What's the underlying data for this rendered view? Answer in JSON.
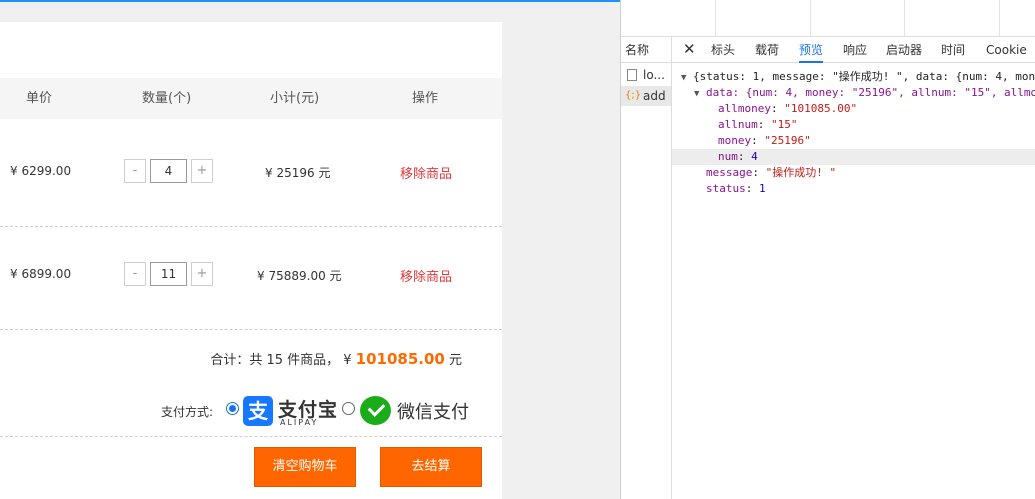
{
  "cart": {
    "headers": {
      "price": "单价",
      "qty": "数量(个)",
      "subtotal": "小计(元)",
      "action": "操作"
    },
    "items": [
      {
        "price": "¥  6299.00",
        "qty": "4",
        "subtotal": "¥  25196 元",
        "remove": "移除商品",
        "minus": "-",
        "plus": "+"
      },
      {
        "price": "¥  6899.00",
        "qty": "11",
        "subtotal": "¥  75889.00 元",
        "remove": "移除商品",
        "minus": "-",
        "plus": "+"
      }
    ],
    "total_prefix": "合计：共 15 件商品， ¥ ",
    "total_money": "101085.00",
    "total_suffix": " 元",
    "pay_label": "支付方式:",
    "alipay_glyph": "支",
    "alipay_name": "支付宝",
    "alipay_sub": "ALIPAY",
    "wechat_name": "微信支付",
    "clear_button": "清空购物车",
    "checkout_button": "去结算"
  },
  "devtools": {
    "name_header": "名称",
    "requests": [
      {
        "name": "lo..."
      },
      {
        "name": "add"
      }
    ],
    "xhr_glyph": "{;}",
    "close": "✕",
    "tabs": [
      "标头",
      "载荷",
      "预览",
      "响应",
      "启动器",
      "时间",
      "Cookie"
    ],
    "active_tab": "预览",
    "preview": {
      "summary": "{status: 1, message: \"操作成功! \", data: {num: 4, mon",
      "data_summary": "data: {num: 4, money: \"25196\", allnum: \"15\", allmo",
      "allmoney": "\"101085.00\"",
      "allnum": "\"15\"",
      "money": "\"25196\"",
      "num": "4",
      "message": "\"操作成功! \"",
      "status": "1"
    }
  }
}
